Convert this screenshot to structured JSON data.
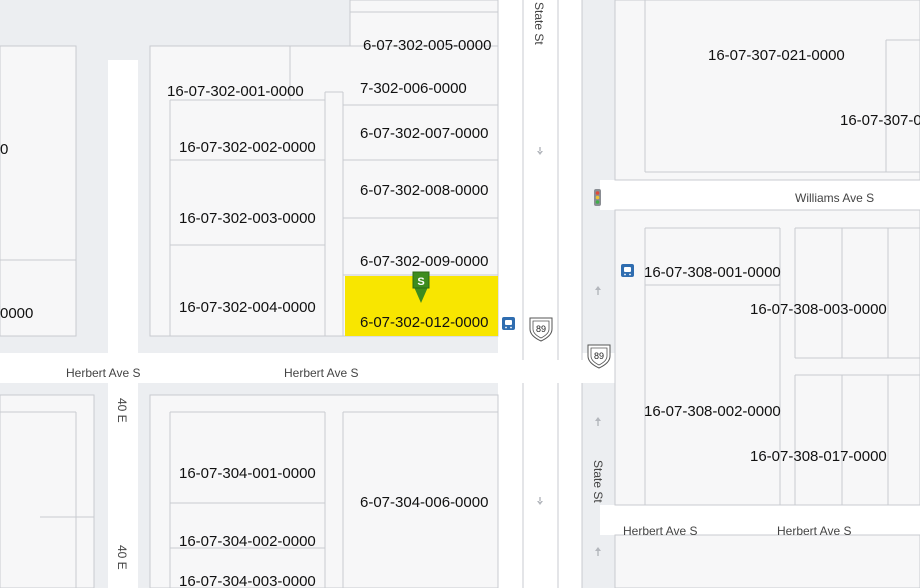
{
  "parcels": {
    "p005": "6-07-302-005-0000",
    "p001": "16-07-302-001-0000",
    "p006": "7-302-006-0000",
    "p002": "16-07-302-002-0000",
    "p007": "6-07-302-007-0000",
    "p008": "6-07-302-008-0000",
    "p003": "16-07-302-003-0000",
    "p009": "6-07-302-009-0000",
    "p004": "16-07-302-004-0000",
    "p012": "6-07-302-012-0000",
    "left_partial_a": "0",
    "left_partial_b": "0000",
    "p307_021": "16-07-307-021-0000",
    "p307_partial": "16-07-307-0",
    "p308_001": "16-07-308-001-0000",
    "p308_003": "16-07-308-003-0000",
    "p308_002": "16-07-308-002-0000",
    "p308_017": "16-07-308-017-0000",
    "p304_001": "16-07-304-001-0000",
    "p304_006": "6-07-304-006-0000",
    "p304_002": "16-07-304-002-0000",
    "p304_003": "16-07-304-003-0000"
  },
  "streets": {
    "state_st_north": "State St",
    "state_st_south": "State St",
    "williams": "Williams Ave S",
    "herbert_west": "Herbert Ave S",
    "herbert_center": "Herbert Ave S",
    "herbert_east_a": "Herbert Ave S",
    "herbert_east_b": "Herbert Ave S",
    "e40_north": "40 E",
    "e40_south": "40 E"
  },
  "shields": {
    "route_a": "89",
    "route_b": "89"
  },
  "marker": {
    "letter": "S"
  },
  "colors": {
    "highlight": "#f8e600",
    "marker": "#3d8c1e",
    "bus": "#2f6db0",
    "block": "#f7f7f8",
    "line": "#c9cbd0",
    "road": "#ffffff"
  },
  "icons": [
    "bus-stop-icon",
    "traffic-light-icon",
    "direction-arrow-icon",
    "route-shield-icon",
    "location-marker-icon"
  ]
}
